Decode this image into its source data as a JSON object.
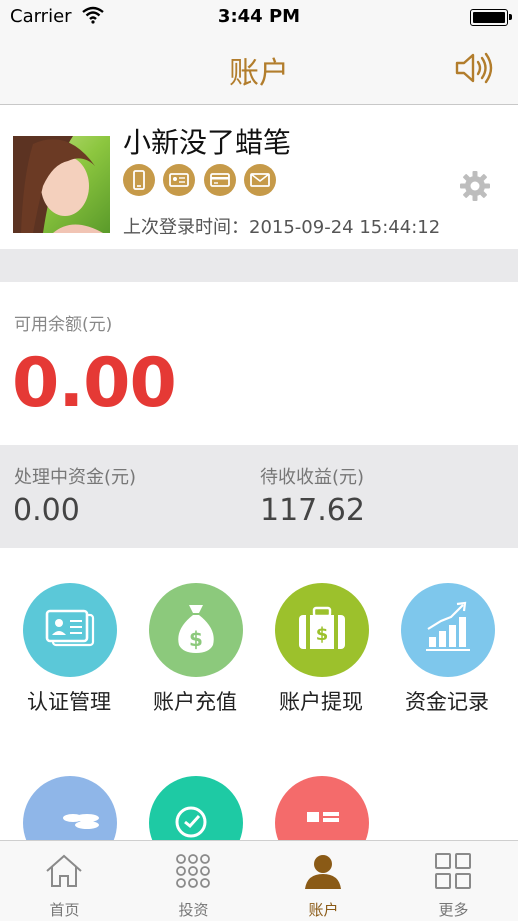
{
  "status_bar": {
    "carrier": "Carrier",
    "time": "3:44 PM"
  },
  "nav": {
    "title": "账户"
  },
  "profile": {
    "username": "小新没了蜡笔",
    "last_login_label": "上次登录时间：2015-09-24 15:44:12"
  },
  "balance": {
    "label": "可用余额(元)",
    "value": "0.00"
  },
  "stats": {
    "processing_label": "处理中资金(元)",
    "processing_value": "0.00",
    "pending_label": "待收收益(元)",
    "pending_value": "117.62"
  },
  "grid": {
    "items": [
      {
        "label": "认证管理",
        "icon": "id-card-icon",
        "color": "#5bc8d8"
      },
      {
        "label": "账户充值",
        "icon": "money-bag-icon",
        "color": "#8cc97c"
      },
      {
        "label": "账户提现",
        "icon": "suitcase-dollar-icon",
        "color": "#9cc12c"
      },
      {
        "label": "资金记录",
        "icon": "bar-chart-icon",
        "color": "#7ec7ec"
      }
    ],
    "partial_colors": [
      "#8fb6e8",
      "#1ecaa4",
      "#f46b6b"
    ]
  },
  "tabs": [
    {
      "label": "首页",
      "icon": "home-icon"
    },
    {
      "label": "投资",
      "icon": "dots-grid-icon"
    },
    {
      "label": "账户",
      "icon": "user-icon",
      "active": true
    },
    {
      "label": "更多",
      "icon": "squares-icon"
    }
  ],
  "colors": {
    "accent": "#b27d2c",
    "balance_red": "#e53935"
  }
}
